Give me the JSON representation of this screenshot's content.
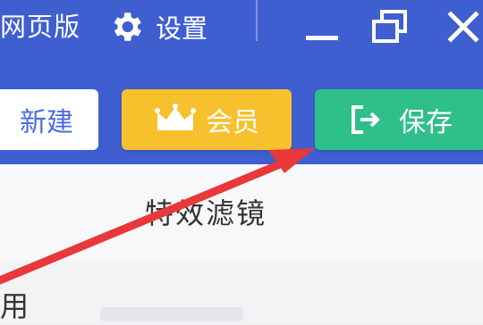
{
  "titlebar": {
    "app_name": "网页版",
    "settings_label": "设置",
    "icons": [
      "gear-icon",
      "minimize-icon",
      "restore-icon",
      "close-icon"
    ]
  },
  "toolbar": {
    "new_label": "新建",
    "vip_label": "会员",
    "save_label": "保存",
    "icons": [
      "crown-icon",
      "exit-icon"
    ]
  },
  "panel": {
    "filter_title": "特效滤镜",
    "lower_text": "用"
  },
  "colors": {
    "header_blue": "#3f5fd0",
    "vip_yellow": "#f7c12d",
    "save_green": "#2fbf8a",
    "arrow_red": "#e8383a"
  }
}
